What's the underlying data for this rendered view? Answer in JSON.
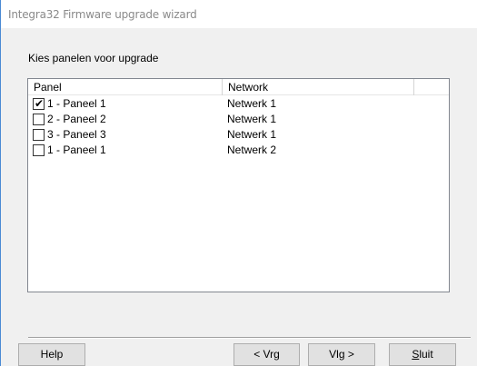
{
  "window": {
    "title": "Integra32 Firmware upgrade wizard"
  },
  "instruction": "Kies panelen voor upgrade",
  "table": {
    "columns": [
      "Panel",
      "Network",
      ""
    ],
    "rows": [
      {
        "checked": true,
        "panel": "1 - Paneel 1",
        "network": "Netwerk 1"
      },
      {
        "checked": false,
        "panel": "2 - Paneel 2",
        "network": "Netwerk 1"
      },
      {
        "checked": false,
        "panel": "3 - Paneel 3",
        "network": "Netwerk 1"
      },
      {
        "checked": false,
        "panel": "1 - Paneel 1",
        "network": "Netwerk 2"
      }
    ]
  },
  "buttons": {
    "help": "Help",
    "prev": "< Vrg",
    "next": "Vlg >",
    "close_accel": "S",
    "close_rest": "luit"
  },
  "icons": {
    "checkmark": "check-icon"
  },
  "colors": {
    "window_border": "#4a8ad4",
    "title_text": "#8a8a8a",
    "dialog_bg": "#f0f0f0",
    "button_bg": "#e1e1e1"
  }
}
